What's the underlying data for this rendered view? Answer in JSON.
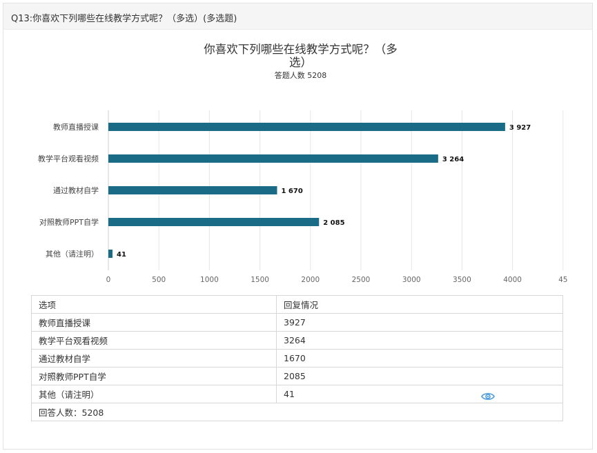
{
  "question": {
    "title": "Q13:你喜欢下列哪些在线教学方式呢？（多选）(多选题)"
  },
  "chart_data": {
    "type": "bar",
    "orientation": "horizontal",
    "title": "你喜欢下列哪些在线教学方式呢？（多选）",
    "subtitle": "答题人数 5208",
    "categories": [
      "教师直播授课",
      "教学平台观看视频",
      "通过教材自学",
      "对照教师PPT自学",
      "其他（请注明）"
    ],
    "values": [
      3927,
      3264,
      1670,
      2085,
      41
    ],
    "data_labels": [
      "3 927",
      "3 264",
      "1 670",
      "2 085",
      "41"
    ],
    "xlim": [
      0,
      4500
    ],
    "x_ticks": [
      "0",
      "500",
      "1000",
      "1500",
      "2000",
      "2500",
      "3000",
      "3500",
      "4000",
      "45"
    ],
    "grid": true,
    "bar_color": "#1a6b86"
  },
  "table": {
    "headers": [
      "选项",
      "回复情况"
    ],
    "rows": [
      [
        "教师直播授课",
        "3927"
      ],
      [
        "教学平台观看视频",
        "3264"
      ],
      [
        "通过教材自学",
        "1670"
      ],
      [
        "对照教师PPT自学",
        "2085"
      ],
      [
        "其他（请注明）",
        "41"
      ]
    ],
    "footer": "回答人数：5208",
    "view_icon": "eye-icon"
  }
}
